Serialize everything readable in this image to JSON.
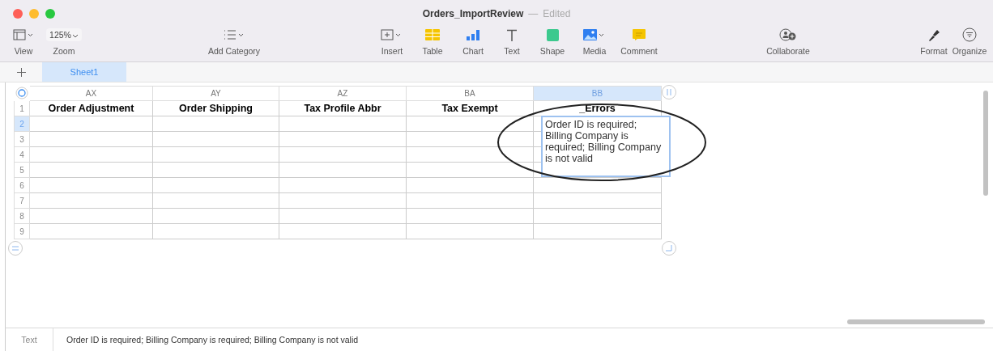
{
  "window": {
    "title": "Orders_ImportReview",
    "separator": "—",
    "status": "Edited"
  },
  "toolbar": [
    {
      "kind": "view",
      "label": "View"
    },
    {
      "kind": "zoom",
      "label": "Zoom",
      "value": "125%"
    },
    {
      "kind": "category",
      "label": "Add Category"
    },
    {
      "kind": "insert",
      "label": "Insert"
    },
    {
      "kind": "table",
      "label": "Table"
    },
    {
      "kind": "chart",
      "label": "Chart"
    },
    {
      "kind": "text",
      "label": "Text"
    },
    {
      "kind": "shape",
      "label": "Shape"
    },
    {
      "kind": "media",
      "label": "Media"
    },
    {
      "kind": "comment",
      "label": "Comment"
    },
    {
      "kind": "collaborate",
      "label": "Collaborate"
    },
    {
      "kind": "format",
      "label": "Format"
    },
    {
      "kind": "organize",
      "label": "Organize"
    }
  ],
  "sheets": [
    {
      "label": "Sheet1",
      "selected": true
    }
  ],
  "table": {
    "columns": [
      {
        "letter": "AX",
        "header": "Order Adjustment",
        "selected": false
      },
      {
        "letter": "AY",
        "header": "Order Shipping",
        "selected": false
      },
      {
        "letter": "AZ",
        "header": "Tax Profile Abbr",
        "selected": false
      },
      {
        "letter": "BA",
        "header": "Tax Exempt",
        "selected": false
      },
      {
        "letter": "BB",
        "header": "_Errors",
        "selected": true
      }
    ],
    "rows": [
      {
        "number": "1",
        "selected": false
      },
      {
        "number": "2",
        "selected": true
      },
      {
        "number": "3",
        "selected": false
      },
      {
        "number": "4",
        "selected": false
      },
      {
        "number": "5",
        "selected": false
      },
      {
        "number": "6",
        "selected": false
      },
      {
        "number": "7",
        "selected": false
      },
      {
        "number": "8",
        "selected": false
      },
      {
        "number": "9",
        "selected": false
      }
    ],
    "editing_cell": {
      "value": "Order ID is required; Billing Company is required; Billing Company is not valid"
    }
  },
  "status_bar": {
    "label": "Text",
    "value": "Order ID is required; Billing Company is required; Billing Company is not valid"
  }
}
